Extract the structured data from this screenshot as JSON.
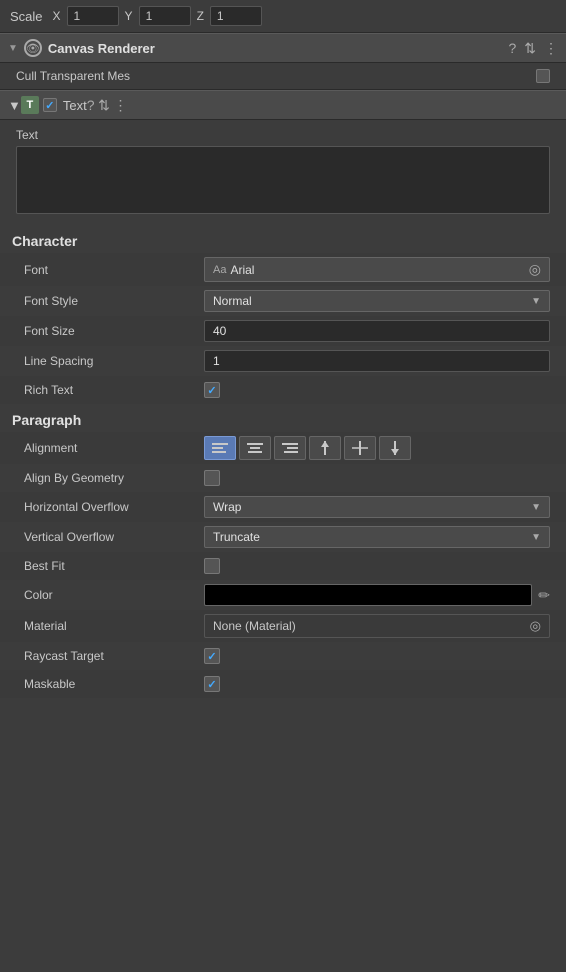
{
  "scale": {
    "label": "Scale",
    "x_label": "X",
    "y_label": "Y",
    "z_label": "Z",
    "x_value": "1",
    "y_value": "1",
    "z_value": "1"
  },
  "canvas_renderer": {
    "title": "Canvas Renderer",
    "cull_label": "Cull Transparent Mes"
  },
  "text_section": {
    "title": "Text",
    "text_label": "Text",
    "text_value": ""
  },
  "character": {
    "label": "Character",
    "font_label": "Font",
    "font_aa": "Aa",
    "font_name": "Arial",
    "font_style_label": "Font Style",
    "font_style_value": "Normal",
    "font_size_label": "Font Size",
    "font_size_value": "40",
    "line_spacing_label": "Line Spacing",
    "line_spacing_value": "1",
    "rich_text_label": "Rich Text"
  },
  "paragraph": {
    "label": "Paragraph",
    "alignment_label": "Alignment",
    "align_buttons": [
      {
        "label": "≡",
        "icon": "align-left",
        "active": true
      },
      {
        "label": "≡",
        "icon": "align-center",
        "active": false
      },
      {
        "label": "≡",
        "icon": "align-right",
        "active": false
      },
      {
        "label": "≡",
        "icon": "align-top",
        "active": false
      },
      {
        "label": "≡",
        "icon": "align-middle",
        "active": false
      },
      {
        "label": "≡",
        "icon": "align-bottom",
        "active": false
      }
    ],
    "align_by_geometry_label": "Align By Geometry",
    "horizontal_overflow_label": "Horizontal Overflow",
    "horizontal_overflow_value": "Wrap",
    "vertical_overflow_label": "Vertical Overflow",
    "vertical_overflow_value": "Truncate",
    "best_fit_label": "Best Fit"
  },
  "color_label": "Color",
  "material_label": "Material",
  "material_value": "None (Material)",
  "raycast_target_label": "Raycast Target",
  "maskable_label": "Maskable",
  "icons": {
    "chevron_down": "▼",
    "chevron_right": "▶",
    "eye": "👁",
    "question": "?",
    "sliders": "⇅",
    "more": "⋮",
    "checkmark": "✓",
    "target": "◎",
    "eyedropper": "✏"
  }
}
